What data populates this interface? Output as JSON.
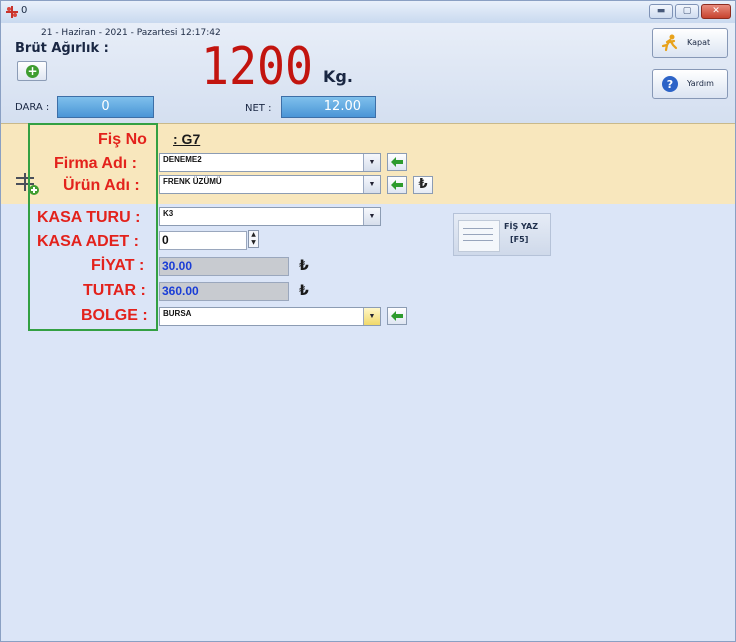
{
  "window": {
    "title": "0",
    "colors": {
      "accent_red": "#e3221c",
      "display_red": "#c2140f",
      "field_blue": "#4a95d6",
      "form_yellow": "#f8e7bd",
      "frame_green": "#33a043"
    }
  },
  "header": {
    "date_time": "21 - Haziran - 2021 - Pazartesi   12:17:42",
    "brut_label": "Brüt Ağırlık :",
    "weight_value": "1200",
    "weight_unit": "Kg.",
    "dara_label": "DARA :",
    "dara_value": "0",
    "net_label": "NET :",
    "net_value": "12.00",
    "kapat_label": "Kapat",
    "yardim_label": "Yardım"
  },
  "form": {
    "fis_no_label": "Fiş No",
    "fis_no_value": ": G7",
    "firma_label": "Firma Adı :",
    "firma_value": "DENEME2",
    "urun_label": "Ürün Adı :",
    "urun_value": "FRENK ÜZÜMÜ",
    "kasa_turu_label": "KASA TURU :",
    "kasa_turu_value": "K3",
    "kasa_adet_label": "KASA ADET :",
    "kasa_adet_value": "0",
    "fiyat_label": "FİYAT :",
    "fiyat_value": "30.00",
    "tutar_label": "TUTAR :",
    "tutar_value": "360.00",
    "bolge_label": "BOLGE :",
    "bolge_value": "BURSA",
    "currency_symbol": "₺",
    "fis_yaz_label": "FİŞ YAZ",
    "fis_yaz_shortcut": "[F5]"
  }
}
